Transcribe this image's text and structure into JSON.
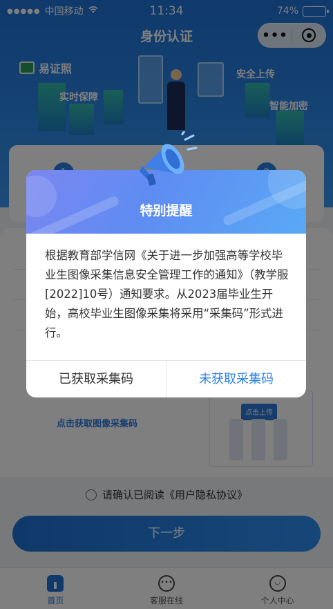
{
  "status_bar": {
    "signal": "●●●●●",
    "carrier": "中国移动",
    "wifi_icon": "wifi-icon",
    "time": "11:34",
    "battery": "74%",
    "battery_level": 0.74
  },
  "header": {
    "title": "身份认证",
    "more_icon": "more-dots-icon",
    "close_icon": "target-circle-icon"
  },
  "hero": {
    "logo": "易证照",
    "tags": [
      "实时保障",
      "安全上传",
      "智能加密"
    ]
  },
  "steps": [
    "1",
    "2"
  ],
  "upload": {
    "link": "点击获取图像采集码",
    "qr_badge": "点击上传"
  },
  "agreement": "请确认已阅读《用户隐私协议》",
  "next_button": "下一步",
  "tabbar": {
    "items": [
      {
        "label": "首页",
        "icon": "home-icon",
        "active": true
      },
      {
        "label": "客服在线",
        "icon": "chat-icon",
        "active": false
      },
      {
        "label": "个人中心",
        "icon": "user-icon",
        "active": false
      }
    ]
  },
  "dialog": {
    "icon": "megaphone-icon",
    "title": "特别提醒",
    "body": "根据教育部学信网《关于进一步加强高等学校毕业生图像采集信息安全管理工作的通知》（教学服[2022]10号）通知要求。从2023届毕业生开始，高校毕业生图像采集将采用“采集码”形式进行。",
    "left_button": "已获取采集码",
    "right_button": "未获取采集码"
  },
  "colors": {
    "brand_blue": "#1f72d6",
    "dialog_link": "#2b82e6"
  }
}
